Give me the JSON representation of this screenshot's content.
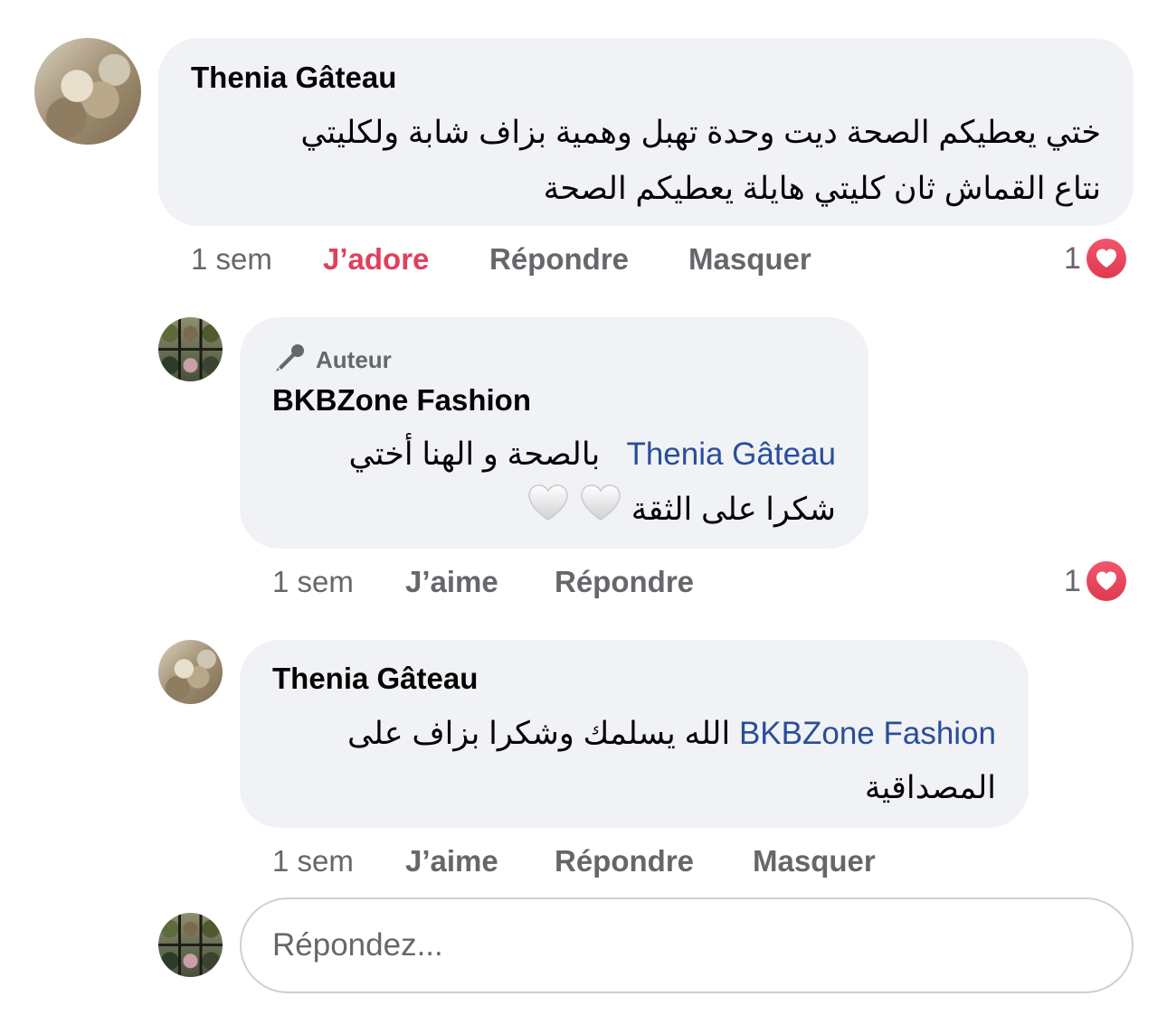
{
  "comments": [
    {
      "author": "Thenia Gâteau",
      "text_line1": "ختي يعطيكم الصحة ديت وحدة تهبل وهمية بزاف شابة ولكليتي",
      "text_line2": "نتاع القماش ثان كليتي هايلة يعطيكم الصحة",
      "time": "1 sem",
      "like_label": "J’adore",
      "reply_label": "Répondre",
      "hide_label": "Masquer",
      "reaction_count": "1"
    },
    {
      "badge_label": "Auteur",
      "author": "BKBZone Fashion",
      "mention": "Thenia Gâteau",
      "text_line1": "بالصحة و الهنا أختي",
      "text_line2": "شكرا على الثقة",
      "time": "1 sem",
      "like_label": "J’aime",
      "reply_label": "Répondre",
      "reaction_count": "1"
    },
    {
      "author": "Thenia Gâteau",
      "mention": "BKBZone Fashion",
      "text_line1": "الله يسلمك وشكرا بزاف على",
      "text_line2": "المصداقية",
      "time": "1 sem",
      "like_label": "J’aime",
      "reply_label": "Répondre",
      "hide_label": "Masquer"
    }
  ],
  "reply_box": {
    "placeholder": "Répondez..."
  },
  "colors": {
    "bubble": "#f0f2f5",
    "mention": "#2a4d9a",
    "love": "#e0405d",
    "meta": "#65676b"
  },
  "icons": [
    "microphone-icon",
    "heart-reaction-icon",
    "white-heart-emoji"
  ]
}
